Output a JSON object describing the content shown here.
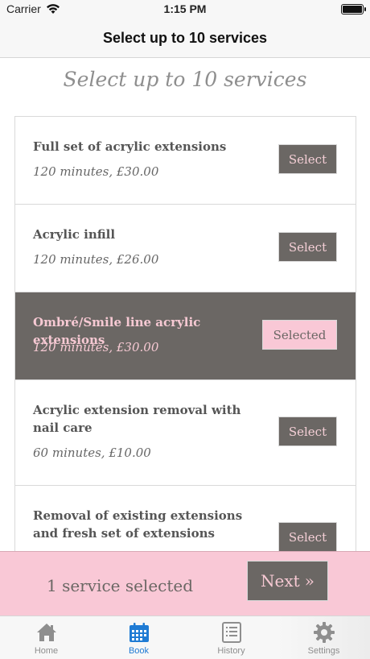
{
  "status_bar": {
    "carrier": "Carrier",
    "time": "1:15 PM"
  },
  "nav": {
    "title": "Select up to 10 services"
  },
  "heading": "Select up to 10 services",
  "services": [
    {
      "name": "Full set of acrylic extensions",
      "meta": "120 minutes, £30.00",
      "button": "Select"
    },
    {
      "name": "Acrylic infill",
      "meta": "120 minutes, £26.00",
      "button": "Select"
    },
    {
      "name": "Ombré/Smile line acrylic extensions",
      "meta": "120 minutes, £30.00",
      "button": "Selected"
    },
    {
      "name": "Acrylic extension removal with nail care",
      "meta": "60 minutes, £10.00",
      "button": "Select"
    },
    {
      "name": "Removal of existing extensions and fresh set of extensions",
      "meta": "",
      "button": "Select"
    }
  ],
  "summary": {
    "text": "1 service selected",
    "next_label": "Next",
    "next_icon": "»"
  },
  "tabs": [
    {
      "label": "Home",
      "icon": "home-icon"
    },
    {
      "label": "Book",
      "icon": "calendar-icon"
    },
    {
      "label": "History",
      "icon": "list-icon"
    },
    {
      "label": "Settings",
      "icon": "gear-icon"
    }
  ],
  "colors": {
    "primary": "#6b6764",
    "accent_pink": "#f9c8d6",
    "tab_active": "#1f7bd4"
  }
}
